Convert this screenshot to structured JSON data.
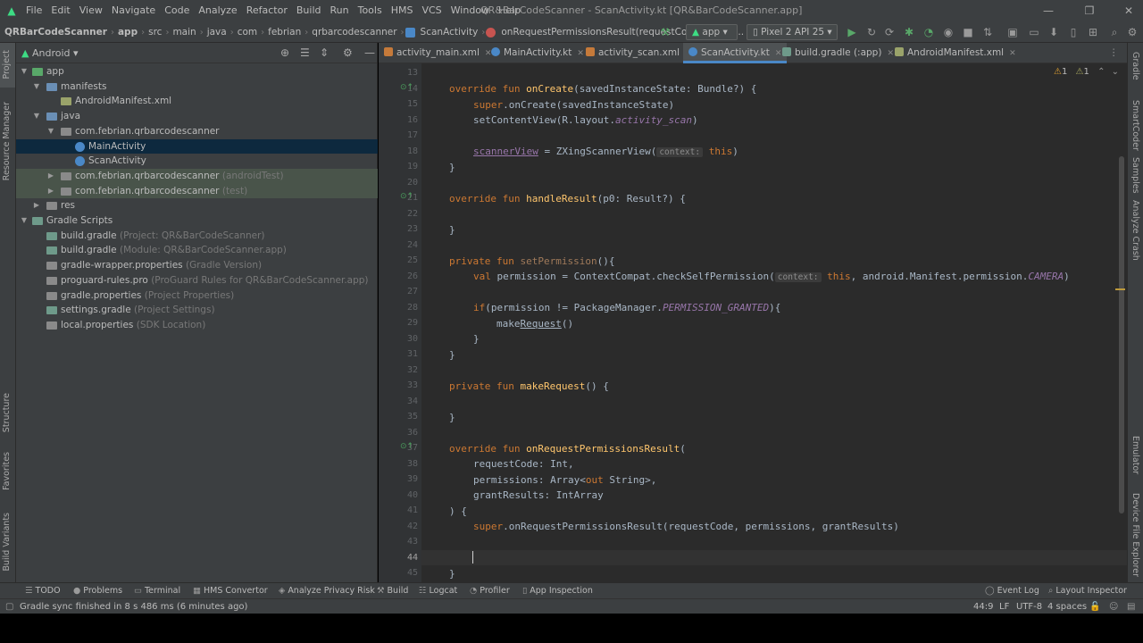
{
  "window": {
    "title": "QR&BarCodeScanner - ScanActivity.kt [QR&BarCodeScanner.app]"
  },
  "menu": [
    "File",
    "Edit",
    "View",
    "Navigate",
    "Code",
    "Analyze",
    "Refactor",
    "Build",
    "Run",
    "Tools",
    "HMS",
    "VCS",
    "Window",
    "Help"
  ],
  "breadcrumb": [
    "QRBarCodeScanner",
    "app",
    "src",
    "main",
    "java",
    "com",
    "febrian",
    "qrbarcodescanner",
    "ScanActivity",
    "onRequestPermissionsResult(requestCode: Int, pe..."
  ],
  "toolbar": {
    "config": "app",
    "device": "Pixel 2 API 25"
  },
  "project_panel": {
    "view": "Android",
    "tree": [
      {
        "label": "app",
        "hint": ""
      },
      {
        "label": "manifests",
        "hint": ""
      },
      {
        "label": "AndroidManifest.xml",
        "hint": ""
      },
      {
        "label": "java",
        "hint": ""
      },
      {
        "label": "com.febrian.qrbarcodescanner",
        "hint": ""
      },
      {
        "label": "MainActivity",
        "hint": ""
      },
      {
        "label": "ScanActivity",
        "hint": ""
      },
      {
        "label": "com.febrian.qrbarcodescanner",
        "hint": "(androidTest)"
      },
      {
        "label": "com.febrian.qrbarcodescanner",
        "hint": "(test)"
      },
      {
        "label": "res",
        "hint": ""
      },
      {
        "label": "Gradle Scripts",
        "hint": ""
      },
      {
        "label": "build.gradle",
        "hint": "(Project: QR&BarCodeScanner)"
      },
      {
        "label": "build.gradle",
        "hint": "(Module: QR&BarCodeScanner.app)"
      },
      {
        "label": "gradle-wrapper.properties",
        "hint": "(Gradle Version)"
      },
      {
        "label": "proguard-rules.pro",
        "hint": "(ProGuard Rules for QR&BarCodeScanner.app)"
      },
      {
        "label": "gradle.properties",
        "hint": "(Project Properties)"
      },
      {
        "label": "settings.gradle",
        "hint": "(Project Settings)"
      },
      {
        "label": "local.properties",
        "hint": "(SDK Location)"
      }
    ]
  },
  "left_strip": [
    "Project",
    "Resource Manager",
    "Structure",
    "Favorites",
    "Build Variants"
  ],
  "right_strip": [
    "Gradle",
    "SmartCoder",
    "Samples",
    "Analyze Crash",
    "Emulator",
    "Device File Explorer"
  ],
  "tabs": [
    "activity_main.xml",
    "MainActivity.kt",
    "activity_scan.xml",
    "ScanActivity.kt",
    "build.gradle (:app)",
    "AndroidManifest.xml"
  ],
  "editor": {
    "line_numbers": [
      "13",
      "14",
      "15",
      "16",
      "17",
      "18",
      "19",
      "20",
      "21",
      "22",
      "23",
      "24",
      "25",
      "26",
      "27",
      "28",
      "29",
      "30",
      "31",
      "32",
      "33",
      "34",
      "35",
      "36",
      "37",
      "38",
      "39",
      "40",
      "41",
      "42",
      "43",
      "44",
      "45"
    ],
    "warnings": "1",
    "weak_warnings": "1",
    "inlay_context": "context:",
    "code": {
      "l14a": "override fun ",
      "l14b": "onCreate",
      "l14c": "(savedInstanceState: Bundle?) {",
      "l15a": "super",
      "l15b": ".onCreate(savedInstanceState)",
      "l16a": "setContentView(R.layout.",
      "l16b": "activity_scan",
      "l16c": ")",
      "l18a": "scannerView",
      "l18b": " = ZXingScannerView(",
      "l18c": "this",
      "l18d": ")",
      "l19": "}",
      "l21a": "override fun ",
      "l21b": "handleResult",
      "l21c": "(p0: Result?) {",
      "l23": "}",
      "l25a": "private fun ",
      "l25b": "setPermission",
      "l25c": "(){",
      "l26a": "val ",
      "l26b": "permission = ContextCompat.checkSelfPermission(",
      "l26c": "this",
      "l26d": ", android.Manifest.permission.",
      "l26e": "CAMERA",
      "l26f": ")",
      "l28a": "if",
      "l28b": "(permission != PackageManager.",
      "l28c": "PERMISSION_GRANTED",
      "l28d": "){",
      "l29a": "make",
      "l29b": "Request",
      "l29c": "()",
      "l30": "}",
      "l31": "}",
      "l33a": "private fun ",
      "l33b": "makeRequest",
      "l33c": "() {",
      "l35": "}",
      "l37a": "override fun ",
      "l37b": "onRequestPermissionsResult",
      "l37c": "(",
      "l38": "requestCode: Int,",
      "l39a": "permissions: Array<",
      "l39b": "out",
      "l39c": " String>,",
      "l40": "grantResults: IntArray",
      "l41": ") {",
      "l42a": "super",
      "l42b": ".onRequestPermissionsResult(requestCode, permissions, grantResults)",
      "l45": "}"
    }
  },
  "bottom_tools": [
    "TODO",
    "Problems",
    "Terminal",
    "HMS Convertor",
    "Analyze Privacy Risk",
    "Build",
    "Logcat",
    "Profiler",
    "App Inspection",
    "Event Log",
    "Layout Inspector"
  ],
  "status": {
    "message": "Gradle sync finished in 8 s 486 ms (6 minutes ago)",
    "position": "44:9",
    "line_sep": "LF",
    "encoding": "UTF-8",
    "indent": "4 spaces"
  },
  "colors": {
    "keyword": "#cc7832",
    "function": "#ffc66d",
    "field": "#9876aa",
    "text": "#a9b7c6",
    "selection": "#0d293e",
    "accent": "#4a88c7"
  }
}
